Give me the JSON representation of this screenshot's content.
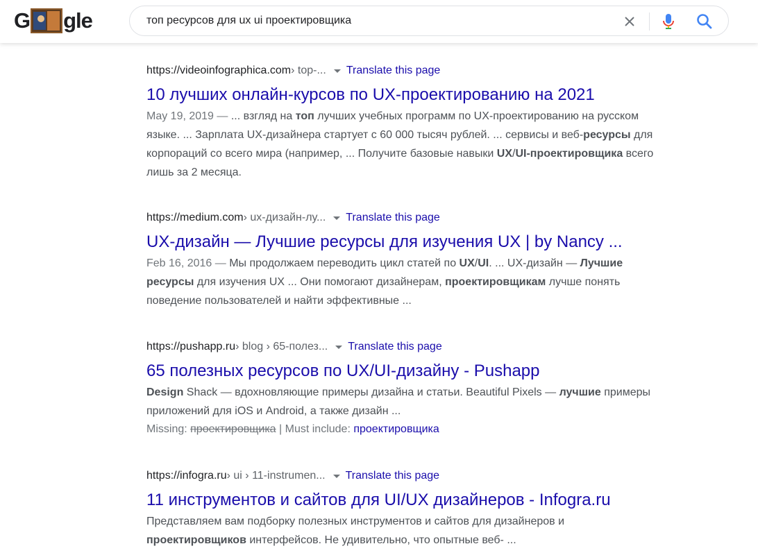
{
  "search": {
    "query": "топ ресурсов для ux ui проектировщика",
    "logo_left": "G",
    "logo_right": "gle"
  },
  "results": [
    {
      "domain": "https://videoinfographica.com",
      "path": " › top-...",
      "translate": "Translate this page",
      "title": "10 лучших онлайн-курсов по UX-проектированию на 2021",
      "date": "May 19, 2019 — ",
      "snippet_parts": [
        [
          "t",
          "... взгляд на "
        ],
        [
          "b",
          "топ"
        ],
        [
          "t",
          " лучших учебных программ по UX-проектированию на русском языке. ... Зарплата UX-дизайнера стартует с 60 000 тысяч рублей. ... сервисы и веб-"
        ],
        [
          "b",
          "ресурсы"
        ],
        [
          "t",
          " для корпораций со всего мира (например, ... Получите базовые навыки "
        ],
        [
          "b",
          "UX"
        ],
        [
          "t",
          "/"
        ],
        [
          "b",
          "UI-проектировщика"
        ],
        [
          "t",
          " всего лишь за 2 месяца."
        ]
      ]
    },
    {
      "domain": "https://medium.com",
      "path": " › ux-дизайн-лу...",
      "translate": "Translate this page",
      "title": "UX-дизайн — Лучшие ресурсы для изучения UX | by Nancy ...",
      "date": "Feb 16, 2016 — ",
      "snippet_parts": [
        [
          "t",
          "Мы продолжаем переводить цикл статей по "
        ],
        [
          "b",
          "UX"
        ],
        [
          "t",
          "/"
        ],
        [
          "b",
          "UI"
        ],
        [
          "t",
          ". ... UX-дизайн — "
        ],
        [
          "b",
          "Лучшие ресурсы"
        ],
        [
          "t",
          " для изучения UX ... Они помогают дизайнерам, "
        ],
        [
          "b",
          "проектировщикам"
        ],
        [
          "t",
          " лучше понять поведение пользователей и найти эффективные ..."
        ]
      ]
    },
    {
      "domain": "https://pushapp.ru",
      "path": " › blog › 65-полез...",
      "translate": "Translate this page",
      "title": "65 полезных ресурсов по UX/UI-дизайну - Pushapp",
      "date": "",
      "snippet_parts": [
        [
          "b",
          "Design"
        ],
        [
          "t",
          " Shack — вдохновляющие примеры дизайна и статьи. Beautiful Pixels — "
        ],
        [
          "b",
          "лучшие"
        ],
        [
          "t",
          " примеры приложений для iOS и Android, а также дизайн ..."
        ]
      ],
      "missing": {
        "label": "Missing: ",
        "struck": "проектировщика",
        "sep": " | Must include: ",
        "include": "проектировщика"
      }
    },
    {
      "domain": "https://infogra.ru",
      "path": " › ui › 11-instrumen...",
      "translate": "Translate this page",
      "title": "11 инструментов и сайтов для UI/UX дизайнеров - Infogra.ru",
      "date": "",
      "snippet_parts": [
        [
          "t",
          "Представляем вам подборку полезных инструментов и сайтов для дизайнеров и "
        ],
        [
          "b",
          "проектировщиков"
        ],
        [
          "t",
          " интерфейсов. Не удивительно, что опытные веб- ..."
        ]
      ]
    }
  ],
  "colors": {
    "link": "#1a0dab",
    "snippet": "#4d5156",
    "mic_blue": "#4285f4",
    "mic_red": "#ea4335",
    "mic_yellow": "#fbbc05",
    "mic_green": "#34a853",
    "icon_gray": "#70757a"
  }
}
